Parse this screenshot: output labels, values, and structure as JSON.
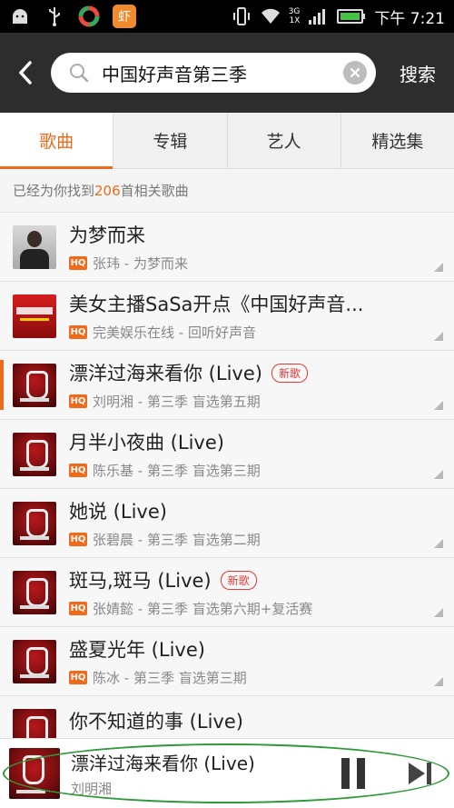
{
  "status_bar": {
    "app_letter": "虾",
    "network_top": "3G",
    "network_bottom": "1X",
    "time": "下午 7:21"
  },
  "header": {
    "search_value": "中国好声音第三季",
    "search_button": "搜索"
  },
  "tabs": [
    {
      "label": "歌曲",
      "active": true
    },
    {
      "label": "专辑",
      "active": false
    },
    {
      "label": "艺人",
      "active": false
    },
    {
      "label": "精选集",
      "active": false
    }
  ],
  "result_summary": {
    "prefix": "已经为你找到",
    "count": "206",
    "suffix": "首相关歌曲"
  },
  "songs": [
    {
      "title": "为梦而来",
      "subtitle": "张玮 - 为梦而来",
      "tag": "",
      "thumb": "person"
    },
    {
      "title": "美女主播SaSa开点《中国好声音...",
      "subtitle": "完美娱乐在线 - 回听好声音",
      "tag": "",
      "thumb": "promo"
    },
    {
      "title": "漂洋过海来看你 (Live)",
      "subtitle": "刘明湘 - 第三季 盲选第五期",
      "tag": "新歌",
      "thumb": "voice"
    },
    {
      "title": "月半小夜曲 (Live)",
      "subtitle": "陈乐基 - 第三季 盲选第三期",
      "tag": "",
      "thumb": "voice"
    },
    {
      "title": "她说 (Live)",
      "subtitle": "张碧晨 - 第三季 盲选第二期",
      "tag": "",
      "thumb": "voice"
    },
    {
      "title": "斑马,斑马 (Live)",
      "subtitle": "张婧懿 - 第三季 盲选第六期+复活赛",
      "tag": "新歌",
      "thumb": "voice"
    },
    {
      "title": "盛夏光年 (Live)",
      "subtitle": "陈冰 - 第三季 盲选第三期",
      "tag": "",
      "thumb": "voice"
    },
    {
      "title": "你不知道的事 (Live)",
      "subtitle": "",
      "tag": "",
      "thumb": "voice"
    }
  ],
  "player": {
    "title": "漂洋过海来看你 (Live)",
    "artist": "刘明湘"
  },
  "colors": {
    "accent": "#f06a1c",
    "header_bg": "#2d2d2d",
    "new_tag": "#e53935",
    "annotation_oval": "#2e9a3a"
  },
  "icons": {
    "back": "chevron-left-icon",
    "search": "search-icon",
    "clear": "clear-icon",
    "hq": "hq-badge-icon",
    "pause": "pause-icon",
    "next": "next-icon"
  }
}
